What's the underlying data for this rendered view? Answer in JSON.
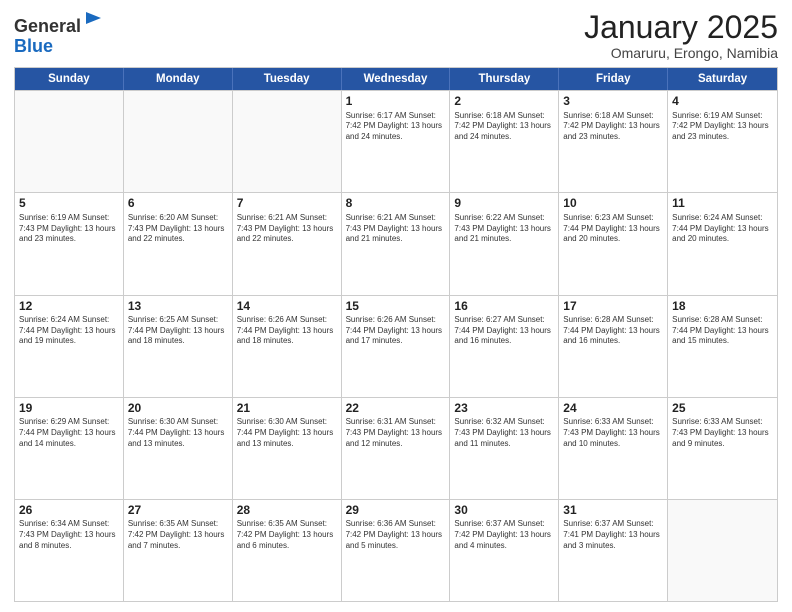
{
  "logo": {
    "general": "General",
    "blue": "Blue"
  },
  "title": "January 2025",
  "subtitle": "Omaruru, Erongo, Namibia",
  "days": [
    "Sunday",
    "Monday",
    "Tuesday",
    "Wednesday",
    "Thursday",
    "Friday",
    "Saturday"
  ],
  "weeks": [
    [
      {
        "day": "",
        "info": ""
      },
      {
        "day": "",
        "info": ""
      },
      {
        "day": "",
        "info": ""
      },
      {
        "day": "1",
        "info": "Sunrise: 6:17 AM\nSunset: 7:42 PM\nDaylight: 13 hours\nand 24 minutes."
      },
      {
        "day": "2",
        "info": "Sunrise: 6:18 AM\nSunset: 7:42 PM\nDaylight: 13 hours\nand 24 minutes."
      },
      {
        "day": "3",
        "info": "Sunrise: 6:18 AM\nSunset: 7:42 PM\nDaylight: 13 hours\nand 23 minutes."
      },
      {
        "day": "4",
        "info": "Sunrise: 6:19 AM\nSunset: 7:42 PM\nDaylight: 13 hours\nand 23 minutes."
      }
    ],
    [
      {
        "day": "5",
        "info": "Sunrise: 6:19 AM\nSunset: 7:43 PM\nDaylight: 13 hours\nand 23 minutes."
      },
      {
        "day": "6",
        "info": "Sunrise: 6:20 AM\nSunset: 7:43 PM\nDaylight: 13 hours\nand 22 minutes."
      },
      {
        "day": "7",
        "info": "Sunrise: 6:21 AM\nSunset: 7:43 PM\nDaylight: 13 hours\nand 22 minutes."
      },
      {
        "day": "8",
        "info": "Sunrise: 6:21 AM\nSunset: 7:43 PM\nDaylight: 13 hours\nand 21 minutes."
      },
      {
        "day": "9",
        "info": "Sunrise: 6:22 AM\nSunset: 7:43 PM\nDaylight: 13 hours\nand 21 minutes."
      },
      {
        "day": "10",
        "info": "Sunrise: 6:23 AM\nSunset: 7:44 PM\nDaylight: 13 hours\nand 20 minutes."
      },
      {
        "day": "11",
        "info": "Sunrise: 6:24 AM\nSunset: 7:44 PM\nDaylight: 13 hours\nand 20 minutes."
      }
    ],
    [
      {
        "day": "12",
        "info": "Sunrise: 6:24 AM\nSunset: 7:44 PM\nDaylight: 13 hours\nand 19 minutes."
      },
      {
        "day": "13",
        "info": "Sunrise: 6:25 AM\nSunset: 7:44 PM\nDaylight: 13 hours\nand 18 minutes."
      },
      {
        "day": "14",
        "info": "Sunrise: 6:26 AM\nSunset: 7:44 PM\nDaylight: 13 hours\nand 18 minutes."
      },
      {
        "day": "15",
        "info": "Sunrise: 6:26 AM\nSunset: 7:44 PM\nDaylight: 13 hours\nand 17 minutes."
      },
      {
        "day": "16",
        "info": "Sunrise: 6:27 AM\nSunset: 7:44 PM\nDaylight: 13 hours\nand 16 minutes."
      },
      {
        "day": "17",
        "info": "Sunrise: 6:28 AM\nSunset: 7:44 PM\nDaylight: 13 hours\nand 16 minutes."
      },
      {
        "day": "18",
        "info": "Sunrise: 6:28 AM\nSunset: 7:44 PM\nDaylight: 13 hours\nand 15 minutes."
      }
    ],
    [
      {
        "day": "19",
        "info": "Sunrise: 6:29 AM\nSunset: 7:44 PM\nDaylight: 13 hours\nand 14 minutes."
      },
      {
        "day": "20",
        "info": "Sunrise: 6:30 AM\nSunset: 7:44 PM\nDaylight: 13 hours\nand 13 minutes."
      },
      {
        "day": "21",
        "info": "Sunrise: 6:30 AM\nSunset: 7:44 PM\nDaylight: 13 hours\nand 13 minutes."
      },
      {
        "day": "22",
        "info": "Sunrise: 6:31 AM\nSunset: 7:43 PM\nDaylight: 13 hours\nand 12 minutes."
      },
      {
        "day": "23",
        "info": "Sunrise: 6:32 AM\nSunset: 7:43 PM\nDaylight: 13 hours\nand 11 minutes."
      },
      {
        "day": "24",
        "info": "Sunrise: 6:33 AM\nSunset: 7:43 PM\nDaylight: 13 hours\nand 10 minutes."
      },
      {
        "day": "25",
        "info": "Sunrise: 6:33 AM\nSunset: 7:43 PM\nDaylight: 13 hours\nand 9 minutes."
      }
    ],
    [
      {
        "day": "26",
        "info": "Sunrise: 6:34 AM\nSunset: 7:43 PM\nDaylight: 13 hours\nand 8 minutes."
      },
      {
        "day": "27",
        "info": "Sunrise: 6:35 AM\nSunset: 7:42 PM\nDaylight: 13 hours\nand 7 minutes."
      },
      {
        "day": "28",
        "info": "Sunrise: 6:35 AM\nSunset: 7:42 PM\nDaylight: 13 hours\nand 6 minutes."
      },
      {
        "day": "29",
        "info": "Sunrise: 6:36 AM\nSunset: 7:42 PM\nDaylight: 13 hours\nand 5 minutes."
      },
      {
        "day": "30",
        "info": "Sunrise: 6:37 AM\nSunset: 7:42 PM\nDaylight: 13 hours\nand 4 minutes."
      },
      {
        "day": "31",
        "info": "Sunrise: 6:37 AM\nSunset: 7:41 PM\nDaylight: 13 hours\nand 3 minutes."
      },
      {
        "day": "",
        "info": ""
      }
    ]
  ]
}
